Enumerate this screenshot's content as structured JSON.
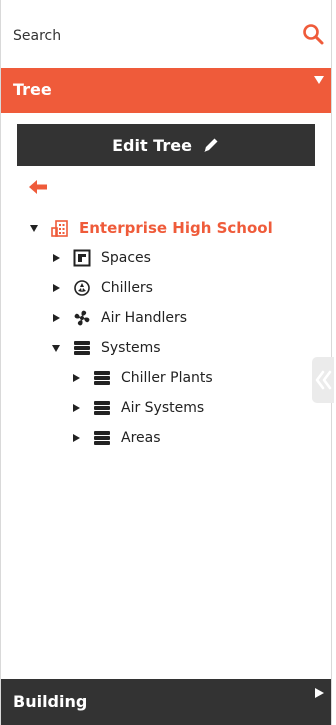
{
  "search": {
    "placeholder": "Search"
  },
  "tree_panel": {
    "title": "Tree"
  },
  "edit_tree": {
    "label": "Edit Tree"
  },
  "tree": {
    "root": {
      "label": "Enterprise High School",
      "expanded": true,
      "icon": "building-icon"
    },
    "children": [
      {
        "label": "Spaces",
        "expanded": false,
        "icon": "spaces-icon"
      },
      {
        "label": "Chillers",
        "expanded": false,
        "icon": "chiller-icon"
      },
      {
        "label": "Air Handlers",
        "expanded": false,
        "icon": "fan-icon"
      },
      {
        "label": "Systems",
        "expanded": true,
        "icon": "systems-icon",
        "children": [
          {
            "label": "Chiller Plants",
            "expanded": false,
            "icon": "systems-icon"
          },
          {
            "label": "Air Systems",
            "expanded": false,
            "icon": "systems-icon"
          },
          {
            "label": "Areas",
            "expanded": false,
            "icon": "systems-icon"
          }
        ]
      }
    ]
  },
  "footer": {
    "title": "Building"
  },
  "colors": {
    "accent": "#ef5b3a",
    "dark": "#333333",
    "handle": "#ebebeb"
  }
}
